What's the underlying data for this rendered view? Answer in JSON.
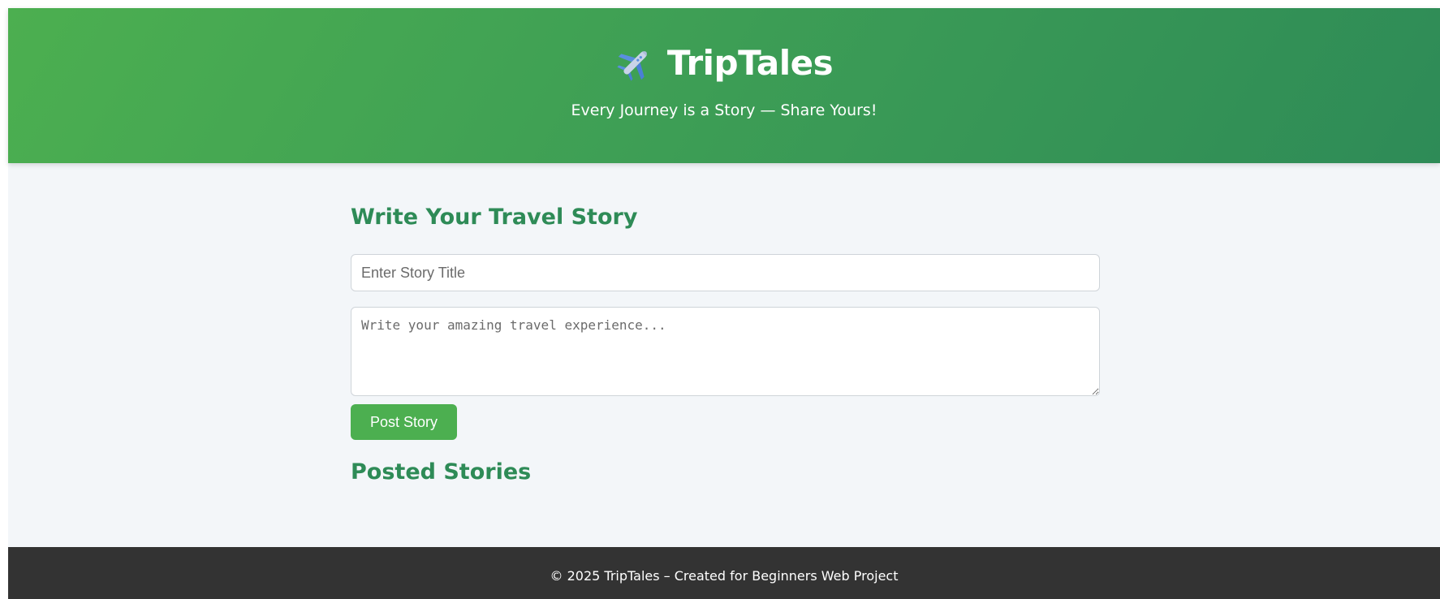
{
  "header": {
    "title": "TripTales",
    "tagline": "Every Journey is a Story — Share Yours!",
    "icon": "airplane-icon"
  },
  "form": {
    "heading": "Write Your Travel Story",
    "title_placeholder": "Enter Story Title",
    "title_value": "",
    "story_placeholder": "Write your amazing travel experience...",
    "story_value": "",
    "post_label": "Post Story"
  },
  "posted": {
    "heading": "Posted Stories",
    "stories": []
  },
  "footer": {
    "text": "© 2025 TripTales – Created for Beginners Web Project"
  },
  "colors": {
    "header_gradient_start": "#4caf50",
    "header_gradient_end": "#2e8b57",
    "heading": "#2e8b57",
    "button": "#4caf50",
    "page_background": "#f3f6f9",
    "footer_background": "#333333"
  }
}
